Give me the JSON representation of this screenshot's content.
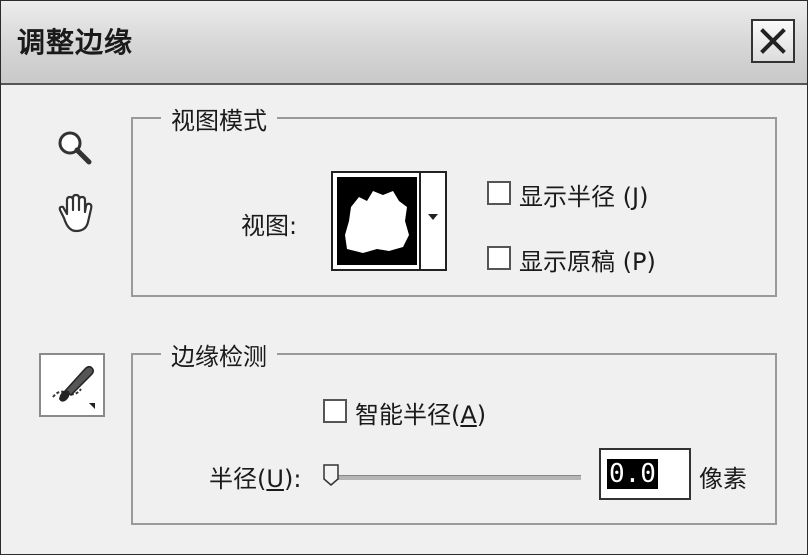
{
  "dialog": {
    "title": "调整边缘",
    "close_icon": "close-icon"
  },
  "tools": {
    "zoom_icon": "zoom-icon",
    "hand_icon": "hand-icon",
    "refine_brush_icon": "refine-radius-brush-icon"
  },
  "view_mode": {
    "legend": "视图模式",
    "view_label": "视图:",
    "view_thumbnail_icon": "mask-thumbnail-icon",
    "dropdown_icon": "dropdown-arrow-icon",
    "show_radius": {
      "label": "显示半径 (J)",
      "checked": false
    },
    "show_original": {
      "label": "显示原稿 (P)",
      "checked": false
    }
  },
  "edge_detection": {
    "legend": "边缘检测",
    "smart_radius": {
      "label_prefix": "智能半径(",
      "hotkey": "A",
      "label_suffix": ")",
      "checked": false
    },
    "radius": {
      "label_prefix": "半径(",
      "hotkey": "U",
      "label_suffix": "):",
      "value": "0.0",
      "unit": "像素",
      "slider_fraction": 0
    }
  }
}
